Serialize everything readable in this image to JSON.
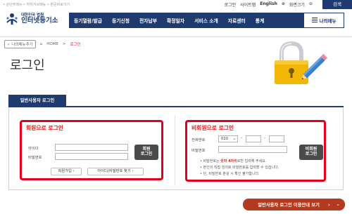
{
  "topbar": {
    "skip_links": "• 상단주메뉴 • 하위서브메뉴 • 본문바로가기",
    "links": [
      "로그인",
      "사이트맵",
      "English",
      "화면크기"
    ],
    "zoom_plus": "⊕",
    "zoom_minus": "⊖",
    "search_label": "검색"
  },
  "logo": {
    "line1": "대한민국 법원",
    "line2": "인터넷등기소"
  },
  "gnb": {
    "items": [
      "등기열람/발급",
      "등기신청",
      "전자납부",
      "확정일자",
      "서비스 소개",
      "자료센터",
      "통계"
    ],
    "my_menu": "나의메뉴",
    "menu_icon": "hamburger-icon"
  },
  "breadcrumb": {
    "fav_label": "나의메뉴추가",
    "home": "HOME",
    "separator": ">",
    "current": "로그인"
  },
  "page": {
    "title": "로그인"
  },
  "tabs": {
    "active": "일반사용자 로그인"
  },
  "member": {
    "title": "회원으로 로그인",
    "id_label": "아이디",
    "pw_label": "비밀번호",
    "login_btn_line1": "회원",
    "login_btn_line2": "로그인",
    "join_btn": "회원가입",
    "find_btn": "아이디/비밀번호 찾기"
  },
  "nonmember": {
    "title": "비회원으로 로그인",
    "phone_label": "전화번호",
    "phone_prefix": "010",
    "pw_label": "비밀번호",
    "login_btn_line1": "비회원",
    "login_btn_line2": "로그인",
    "note1_a": "• 비밀번호는 ",
    "note1_b": "숫자 4자리",
    "note1_c": "로만 입력해 주세요.",
    "note2": "• 본인이 직접 임의로 비밀번호를 입력할 수 있습니다.",
    "note3": "• 단, 비밀번호 분실 시 확인 불가합니다."
  },
  "footer": {
    "guide_label": "일반사용자 로그인 이용안내 보기",
    "guide_arrow": "›",
    "top_arrow": "⌄"
  },
  "colors": {
    "navy": "#1e3a6e",
    "red": "#e3001b",
    "guide": "#b5391e"
  }
}
